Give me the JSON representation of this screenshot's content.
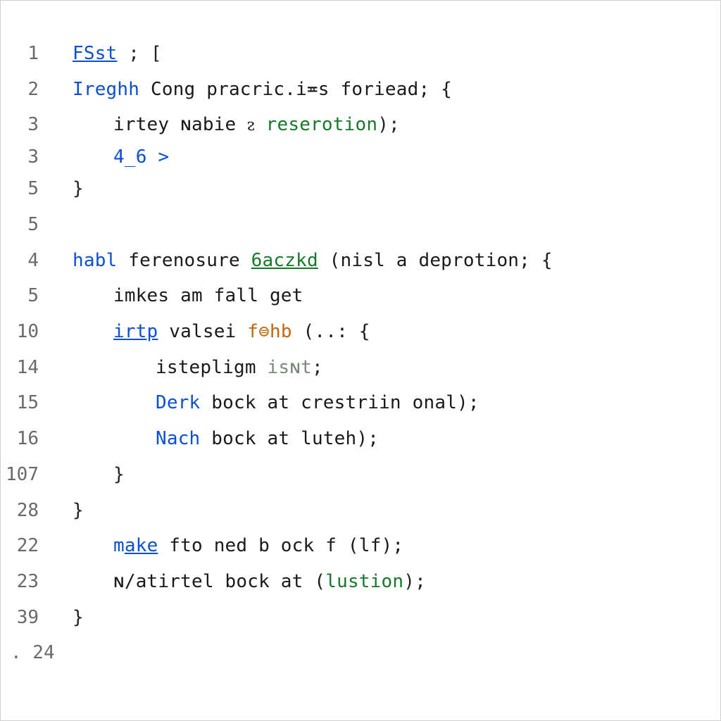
{
  "colors": {
    "keyword": "#0b4fd6",
    "function": "#167a2a",
    "call": "#c4660b",
    "text": "#1a1a1a",
    "gutter": "#6a6a6a",
    "border": "#cfcfcf",
    "background": "#ffffff"
  },
  "lines": [
    {
      "num": "1",
      "indent": 1,
      "tokens": [
        {
          "t": "FSst",
          "cls": "tok-link"
        },
        {
          "t": " ; [",
          "cls": "tok-punc"
        }
      ]
    },
    {
      "num": "2",
      "indent": 1,
      "tokens": [
        {
          "t": "Ireghh",
          "cls": "tok-kw"
        },
        {
          "t": " Cong pracric.i≖s foriead; {",
          "cls": "tok-black"
        }
      ]
    },
    {
      "num": "3",
      "indent": 2,
      "tokens": [
        {
          "t": "irtey ",
          "cls": "tok-black"
        },
        {
          "t": "ɴabie ",
          "cls": "tok-black"
        },
        {
          "t": "ᴤ ",
          "cls": "tok-black"
        },
        {
          "t": "reserotion",
          "cls": "tok-func"
        },
        {
          "t": ");",
          "cls": "tok-punc"
        }
      ]
    },
    {
      "num": "3",
      "indent": 2,
      "tight": true,
      "tokens": [
        {
          "t": "4_6 ",
          "cls": "tok-num"
        },
        {
          "t": ">",
          "cls": "tok-num"
        }
      ]
    },
    {
      "num": "5",
      "indent": 1,
      "tokens": [
        {
          "t": "}",
          "cls": "tok-punc"
        }
      ]
    },
    {
      "num": "5",
      "indent": 1,
      "tokens": [
        {
          "t": " ",
          "cls": "tok-punc"
        }
      ]
    },
    {
      "num": "4",
      "indent": 1,
      "tokens": [
        {
          "t": "habl",
          "cls": "tok-kw"
        },
        {
          "t": " ferenosure ",
          "cls": "tok-black"
        },
        {
          "t": "6aczkd",
          "cls": "tok-func-u"
        },
        {
          "t": " (nisl a deprotion; {",
          "cls": "tok-black"
        }
      ]
    },
    {
      "num": "5",
      "indent": 2,
      "tokens": [
        {
          "t": "imkes am fall get",
          "cls": "tok-black"
        }
      ]
    },
    {
      "num": "10",
      "indent": 2,
      "tokens": [
        {
          "t": "irtp",
          "cls": "tok-link"
        },
        {
          "t": " ",
          "cls": "tok-black"
        },
        {
          "t": "v",
          "cls": "tok-black"
        },
        {
          "t": "alsei ",
          "cls": "tok-black"
        },
        {
          "t": "f⊜hb",
          "cls": "tok-call"
        },
        {
          "t": " (..: {",
          "cls": "tok-black"
        }
      ]
    },
    {
      "num": "14",
      "indent": 3,
      "tokens": [
        {
          "t": "istepligm ",
          "cls": "tok-black"
        },
        {
          "t": "isɴt",
          "cls": "tok-soft"
        },
        {
          "t": ";",
          "cls": "tok-punc"
        }
      ]
    },
    {
      "num": "15",
      "indent": 3,
      "tokens": [
        {
          "t": "Derk",
          "cls": "tok-kw"
        },
        {
          "t": " bock at crestriin onal);",
          "cls": "tok-black"
        }
      ]
    },
    {
      "num": "16",
      "indent": 3,
      "tokens": [
        {
          "t": "Nach",
          "cls": "tok-kw"
        },
        {
          "t": " bock at luteh);",
          "cls": "tok-black"
        }
      ]
    },
    {
      "num": "107",
      "indent": 2,
      "tokens": [
        {
          "t": "}",
          "cls": "tok-punc"
        }
      ]
    },
    {
      "num": "28",
      "indent": 1,
      "tokens": [
        {
          "t": "}",
          "cls": "tok-punc"
        }
      ]
    },
    {
      "num": "22",
      "indent": 2,
      "tokens": [
        {
          "t": "m",
          "cls": "tok-kw"
        },
        {
          "t": "ake",
          "cls": "tok-link"
        },
        {
          "t": " fto ned b ock f (lf);",
          "cls": "tok-black"
        }
      ]
    },
    {
      "num": "23",
      "indent": 2,
      "tokens": [
        {
          "t": "ɴ/atirtel",
          "cls": "tok-black"
        },
        {
          "t": " bock at (",
          "cls": "tok-black"
        },
        {
          "t": "lustion",
          "cls": "tok-func"
        },
        {
          "t": ");",
          "cls": "tok-punc"
        }
      ]
    },
    {
      "num": "39",
      "indent": 1,
      "tokens": [
        {
          "t": "}",
          "cls": "tok-punc"
        }
      ]
    },
    {
      "num": "24",
      "indent": 1,
      "dot": true,
      "tokens": [
        {
          "t": "",
          "cls": "tok-punc"
        }
      ]
    }
  ]
}
